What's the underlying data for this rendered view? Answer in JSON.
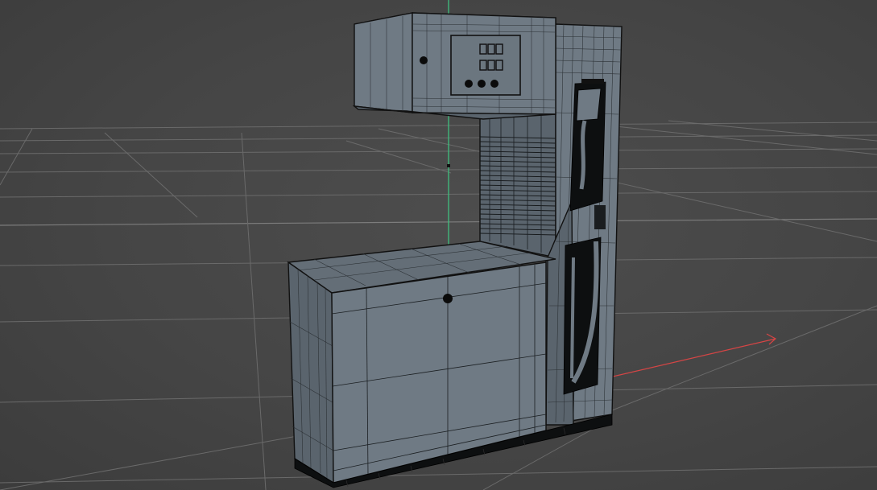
{
  "viewport": {
    "background": "#474747",
    "grid_color": "#6a6a6a"
  },
  "axes": {
    "y_axis_color": "#3fbf7f",
    "x_axis_color": "#d64545"
  },
  "model": {
    "mesh_color": "#6f7a84",
    "wire_color": "#1b1f22"
  }
}
